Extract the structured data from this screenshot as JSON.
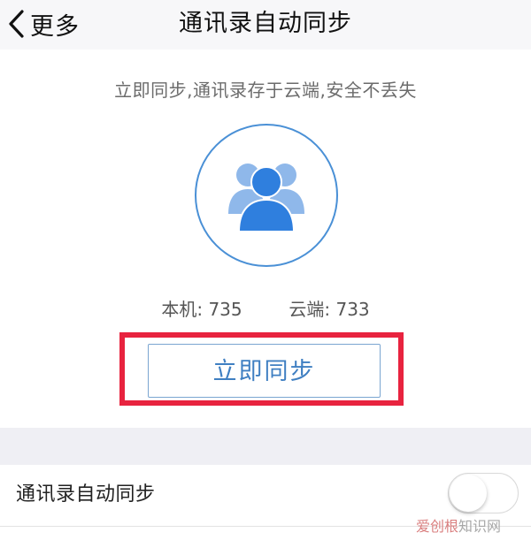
{
  "navbar": {
    "back_label": "更多",
    "title": "通讯录自动同步"
  },
  "sync": {
    "subtitle": "立即同步,通讯录存于云端,安全不丢失",
    "local_label": "本机:",
    "local_count": "735",
    "cloud_label": "云端:",
    "cloud_count": "733",
    "button_label": "立即同步"
  },
  "settings": {
    "auto_sync_label": "通讯录自动同步",
    "auto_sync_enabled": false
  },
  "watermark": {
    "part1": "爱创根",
    "part2": "知识网"
  },
  "colors": {
    "accent": "#3f7fc2",
    "highlight": "#e8233f",
    "icon_front": "#2f7fde",
    "icon_back": "#8fb8ea"
  },
  "icons": {
    "back": "chevron-left-icon",
    "contacts": "users-group-icon"
  }
}
